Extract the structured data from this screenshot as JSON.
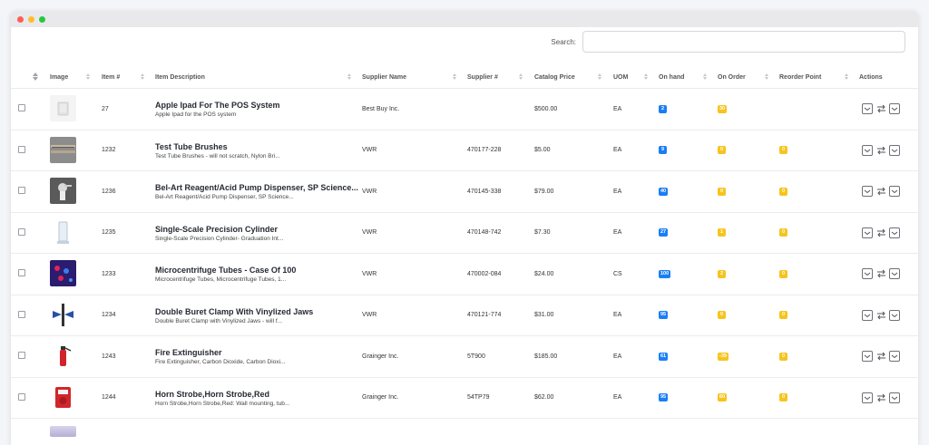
{
  "search": {
    "label": "Search:",
    "value": "",
    "placeholder": ""
  },
  "columns": [
    "Image",
    "Item #",
    "Item Description",
    "Supplier Name",
    "Supplier #",
    "Catalog Price",
    "UOM",
    "On hand",
    "On Order",
    "Reorder Point",
    "Actions"
  ],
  "colors": {
    "badge_blue": "#1a7ef7",
    "badge_yellow": "#f7c41e"
  },
  "rows": [
    {
      "image_icon": "ipad-image",
      "item": "27",
      "title": "Apple Ipad For The POS System",
      "subtitle": "Apple Ipad for the POS system",
      "supplier": "Best Buy Inc.",
      "supplier_no": "",
      "price": "$500.00",
      "uom": "EA",
      "on_hand": "2",
      "on_order": "30",
      "reorder": ""
    },
    {
      "image_icon": "test-tube-brushes-image",
      "item": "1232",
      "title": "Test Tube Brushes",
      "subtitle": "Test Tube Brushes - will not scratch, Nylon Bri...",
      "supplier": "VWR",
      "supplier_no": "470177-228",
      "price": "$5.00",
      "uom": "EA",
      "on_hand": "9",
      "on_order": "0",
      "reorder": "0"
    },
    {
      "image_icon": "pump-dispenser-image",
      "item": "1236",
      "title": "Bel-Art Reagent/Acid Pump Dispenser, SP Science...",
      "subtitle": "Bel-Art Reagent/Acid Pump Dispenser, SP Science...",
      "supplier": "VWR",
      "supplier_no": "470145-338",
      "price": "$79.00",
      "uom": "EA",
      "on_hand": "40",
      "on_order": "0",
      "reorder": "0"
    },
    {
      "image_icon": "cylinder-image",
      "item": "1235",
      "title": "Single-Scale Precision Cylinder",
      "subtitle": "Single-Scale Precision Cylinder- Graduation Int...",
      "supplier": "VWR",
      "supplier_no": "470148-742",
      "price": "$7.30",
      "uom": "EA",
      "on_hand": "27",
      "on_order": "1",
      "reorder": "0"
    },
    {
      "image_icon": "microcentrifuge-tubes-image",
      "item": "1233",
      "title": "Microcentrifuge Tubes - Case Of 100",
      "subtitle": "Microcentrifuge Tubes, Microcentrifuge Tubes, 1...",
      "supplier": "VWR",
      "supplier_no": "470002-084",
      "price": "$24.00",
      "uom": "CS",
      "on_hand": "100",
      "on_order": "2",
      "reorder": "0"
    },
    {
      "image_icon": "buret-clamp-image",
      "item": "1234",
      "title": "Double Buret Clamp With Vinylized Jaws",
      "subtitle": "Double Buret Clamp with Vinylized Jaws - will f...",
      "supplier": "VWR",
      "supplier_no": "470121-774",
      "price": "$31.00",
      "uom": "EA",
      "on_hand": "95",
      "on_order": "0",
      "reorder": "0"
    },
    {
      "image_icon": "fire-extinguisher-image",
      "item": "1243",
      "title": "Fire Extinguisher",
      "subtitle": "Fire Extinguisher, Carbon Dioxide, Carbon Dioxi...",
      "supplier": "Grainger Inc.",
      "supplier_no": "5T900",
      "price": "$185.00",
      "uom": "EA",
      "on_hand": "61",
      "on_order": "-39",
      "reorder": "0"
    },
    {
      "image_icon": "horn-strobe-image",
      "item": "1244",
      "title": "Horn Strobe,Horn Strobe,Red",
      "subtitle": "Horn Strobe,Horn Strobe,Red: Wall mounting, tub...",
      "supplier": "Grainger Inc.",
      "supplier_no": "54TP79",
      "price": "$62.00",
      "uom": "EA",
      "on_hand": "95",
      "on_order": "60",
      "reorder": "0"
    }
  ]
}
